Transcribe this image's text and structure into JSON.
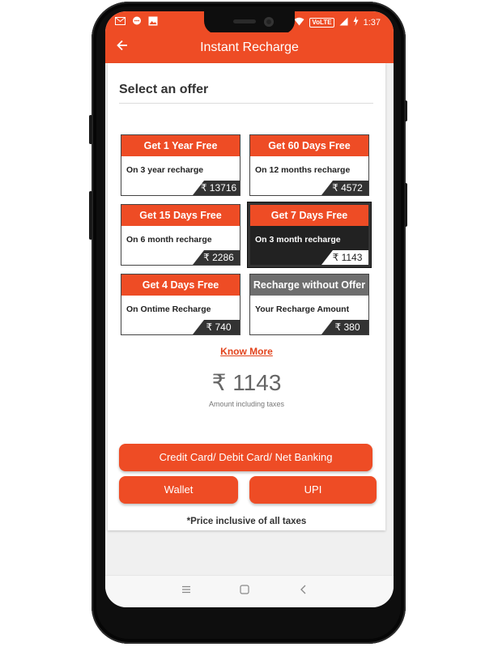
{
  "status": {
    "time": "1:37",
    "volte": "VoLTE"
  },
  "appbar": {
    "title": "Instant Recharge",
    "back_icon": "arrow-left-icon"
  },
  "section": {
    "title": "Select an offer"
  },
  "offers": [
    {
      "head": "Get 1 Year Free",
      "desc": "On 3 year recharge",
      "price": "₹ 13716",
      "selected": false
    },
    {
      "head": "Get 60 Days Free",
      "desc": "On 12 months recharge",
      "price": "₹ 4572",
      "selected": false
    },
    {
      "head": "Get 15 Days Free",
      "desc": "On 6 month recharge",
      "price": "₹ 2286",
      "selected": false
    },
    {
      "head": "Get 7 Days Free",
      "desc": "On 3 month recharge",
      "price": "₹ 1143",
      "selected": true
    },
    {
      "head": "Get 4 Days Free",
      "desc": "On Ontime Recharge",
      "price": "₹ 740",
      "selected": false
    },
    {
      "head": "Recharge without Offer",
      "desc": "Your Recharge Amount",
      "price": "₹ 380",
      "selected": false
    }
  ],
  "know_more": "Know More",
  "amount": {
    "value": "₹ 1143",
    "note": "Amount including taxes"
  },
  "payment": {
    "card_label": "Credit Card/ Debit Card/ Net Banking",
    "wallet_label": "Wallet",
    "upi_label": "UPI"
  },
  "footer_note": "*Price inclusive of all taxes",
  "colors": {
    "accent": "#ee4c25",
    "dark": "#333333",
    "gray_head": "#6e6e6e"
  }
}
